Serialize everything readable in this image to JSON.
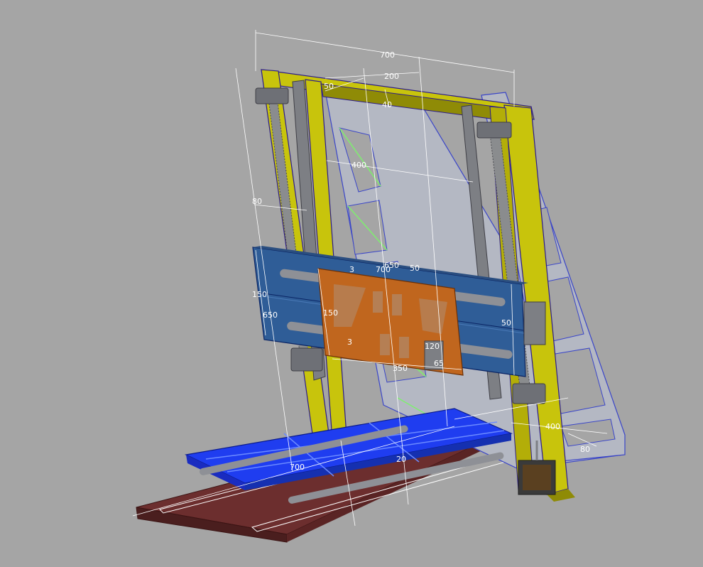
{
  "colors": {
    "background": "#a5a5a5",
    "frame": "#c8c40c",
    "frame_dark": "#8f8b06",
    "outline": "#2b1b8a",
    "truss": "#b4b8c3",
    "truss_edge": "#3a45c8",
    "truss_highlight": "#7ef06e",
    "rod": "#7d7f84",
    "x_carriage": "#2f5d97",
    "z_plate": "#c0661e",
    "y_table": "#1f3df0",
    "base_plate": "#6c2e2e",
    "dimension": "#ffffff"
  },
  "dimensions": {
    "top_width": "700",
    "top_gap": "200",
    "top_offset": "50",
    "top_depth": "40",
    "inner_span": "400",
    "side_left": "80",
    "carriage_height": "150",
    "carriage_side_height": "650",
    "carriage_thickness": "3",
    "carriage_width": "700",
    "carriage_width_b": "650",
    "carriage_right": "50",
    "plate_height": "150",
    "plate_right": "50",
    "plate_thickness": "3",
    "hole_spacing": "120",
    "hole_offset": "65",
    "plate_width": "350",
    "base_width": "400",
    "base_side": "80",
    "table_width": "700",
    "table_gap": "20"
  }
}
